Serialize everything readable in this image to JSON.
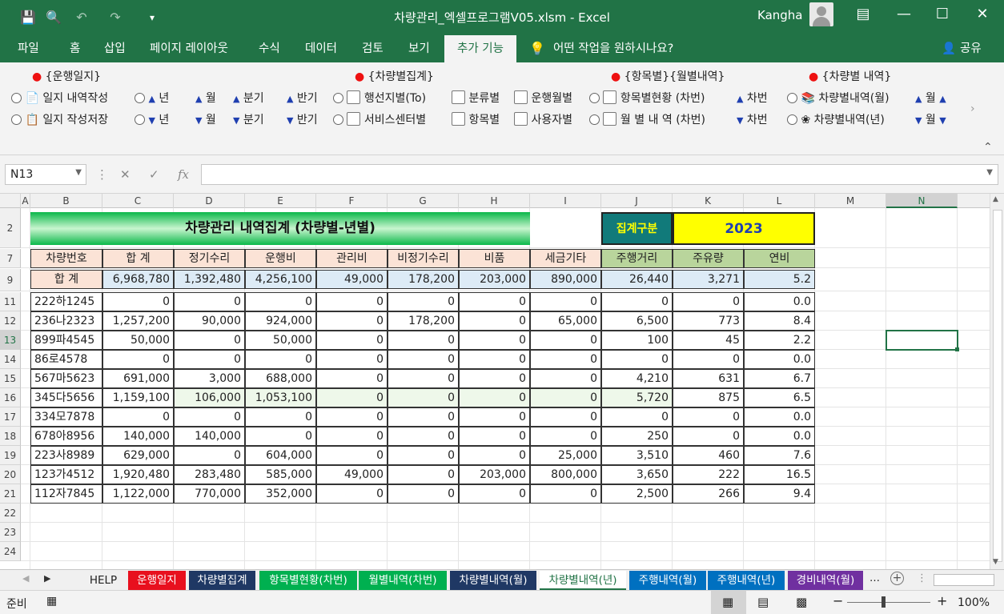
{
  "window": {
    "title": "차량관리_엑셀프로그램V05.xlsm  -  Excel",
    "user": "Kangha",
    "share": "공유",
    "search": "어떤 작업을 원하시나요?"
  },
  "ribbon_tabs": [
    "파일",
    "홈",
    "삽입",
    "페이지 레이아웃",
    "수식",
    "데이터",
    "검토",
    "보기",
    "추가 기능"
  ],
  "ribbon": {
    "g1_title": "{운행일지}",
    "g1_r1": "일지 내역작성",
    "g1_r2": "일지 작성저장",
    "up_year": "년",
    "up_month": "월",
    "up_quarter": "분기",
    "up_half": "반기",
    "g2_title": "{차량별집계}",
    "g2_a1": "행선지별(To)",
    "g2_a2": "서비스센터별",
    "g2_b1": "분류별",
    "g2_b2": "항목별",
    "g2_c1": "운행월별",
    "g2_c2": "사용자별",
    "g3_title": "{항목별}{월별내역}",
    "g3_r1": "항목별현황 (차번)",
    "g3_r2": "월 별 내 역 (차번)",
    "g3_car": "차번",
    "g4_title": "{차량별 내역}",
    "g4_r1": "차량별내역(월)",
    "g4_r2": "차량별내역(년)",
    "g4_m": "월"
  },
  "formula": {
    "namebox": "N13",
    "fx": "fx",
    "value": ""
  },
  "columns": [
    "A",
    "B",
    "C",
    "D",
    "E",
    "F",
    "G",
    "H",
    "I",
    "J",
    "K",
    "L",
    "M",
    "N"
  ],
  "rows": [
    "2",
    "7",
    "9",
    "11",
    "12",
    "13",
    "14",
    "15",
    "16",
    "17",
    "18",
    "19",
    "20",
    "21",
    "22",
    "23",
    "24"
  ],
  "sheet": {
    "title": "차량관리 내역집계 (차량별-년별)",
    "period_label": "집계구분",
    "period_value": "2023",
    "headers": [
      "차량번호",
      "합  계",
      "정기수리",
      "운행비",
      "관리비",
      "비정기수리",
      "비품",
      "세금기타",
      "주행거리",
      "주유량",
      "연비"
    ],
    "total": [
      "합  계",
      "6,968,780",
      "1,392,480",
      "4,256,100",
      "49,000",
      "178,200",
      "203,000",
      "890,000",
      "26,440",
      "3,271",
      "5.2"
    ],
    "data": [
      [
        "222하1245",
        "0",
        "0",
        "0",
        "0",
        "0",
        "0",
        "0",
        "0",
        "0",
        "0.0"
      ],
      [
        "236나2323",
        "1,257,200",
        "90,000",
        "924,000",
        "0",
        "178,200",
        "0",
        "65,000",
        "6,500",
        "773",
        "8.4"
      ],
      [
        "899파4545",
        "50,000",
        "0",
        "50,000",
        "0",
        "0",
        "0",
        "0",
        "100",
        "45",
        "2.2"
      ],
      [
        "86로4578",
        "0",
        "0",
        "0",
        "0",
        "0",
        "0",
        "0",
        "0",
        "0",
        "0.0"
      ],
      [
        "567마5623",
        "691,000",
        "3,000",
        "688,000",
        "0",
        "0",
        "0",
        "0",
        "4,210",
        "631",
        "6.7"
      ],
      [
        "345다5656",
        "1,159,100",
        "106,000",
        "1,053,100",
        "0",
        "0",
        "0",
        "0",
        "5,720",
        "875",
        "6.5"
      ],
      [
        "334모7878",
        "0",
        "0",
        "0",
        "0",
        "0",
        "0",
        "0",
        "0",
        "0",
        "0.0"
      ],
      [
        "678아8956",
        "140,000",
        "140,000",
        "0",
        "0",
        "0",
        "0",
        "0",
        "250",
        "0",
        "0.0"
      ],
      [
        "223사8989",
        "629,000",
        "0",
        "604,000",
        "0",
        "0",
        "0",
        "25,000",
        "3,510",
        "460",
        "7.6"
      ],
      [
        "123가4512",
        "1,920,480",
        "283,480",
        "585,000",
        "49,000",
        "0",
        "203,000",
        "800,000",
        "3,650",
        "222",
        "16.5"
      ],
      [
        "112자7845",
        "1,122,000",
        "770,000",
        "352,000",
        "0",
        "0",
        "0",
        "0",
        "2,500",
        "266",
        "9.4"
      ]
    ]
  },
  "sheet_tabs": [
    {
      "label": "HELP",
      "color": "#f0f0f0",
      "fg": "#222"
    },
    {
      "label": "운행일지",
      "color": "#e8101e",
      "fg": "#ffffff"
    },
    {
      "label": "차량별집계",
      "color": "#1f3864",
      "fg": "#ffffff"
    },
    {
      "label": "항목별현황(차번)",
      "color": "#00b050",
      "fg": "#ffffff"
    },
    {
      "label": "월별내역(차번)",
      "color": "#00b050",
      "fg": "#ffffff"
    },
    {
      "label": "차량별내역(월)",
      "color": "#1f3864",
      "fg": "#ffffff"
    },
    {
      "label": "차량별내역(년)",
      "color": "#ffffff",
      "fg": "#217346"
    },
    {
      "label": "주행내역(월)",
      "color": "#0070c0",
      "fg": "#ffffff"
    },
    {
      "label": "주행내역(년)",
      "color": "#0070c0",
      "fg": "#ffffff"
    },
    {
      "label": "경비내역(월)",
      "color": "#7030a0",
      "fg": "#ffffff"
    }
  ],
  "status": {
    "ready": "준비",
    "zoom": "100%"
  }
}
